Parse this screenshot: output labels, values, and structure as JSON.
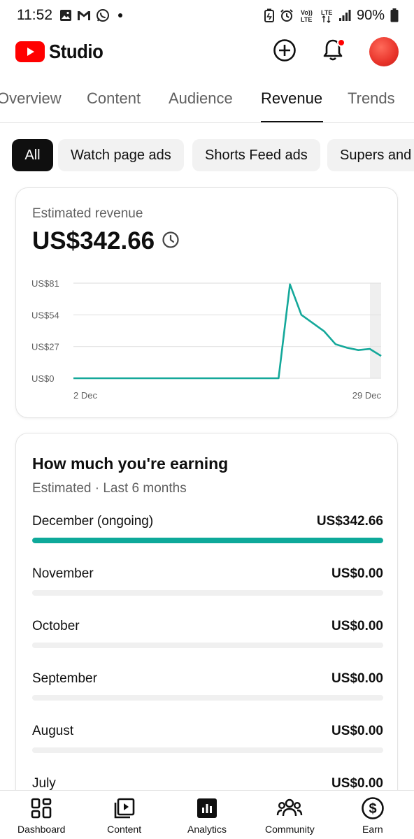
{
  "status_bar": {
    "time": "11:52",
    "battery": "90%",
    "network": "LTE",
    "left_icons": [
      "gallery-icon",
      "gmail-icon",
      "whatsapp-icon"
    ],
    "right_icons": [
      "battery-saver-icon",
      "alarm-icon",
      "volte-icon",
      "lte-icon",
      "signal-icon",
      "battery-icon"
    ]
  },
  "app_bar": {
    "brand": "Studio",
    "brand_color": "#ff0000",
    "icons": [
      "create-icon",
      "notifications-icon",
      "avatar"
    ]
  },
  "tabs": [
    {
      "label": "Overview",
      "active": false
    },
    {
      "label": "Content",
      "active": false
    },
    {
      "label": "Audience",
      "active": false
    },
    {
      "label": "Revenue",
      "active": true
    },
    {
      "label": "Trends",
      "active": false
    }
  ],
  "chips": [
    {
      "label": "All",
      "active": true
    },
    {
      "label": "Watch page ads",
      "active": false
    },
    {
      "label": "Shorts Feed ads",
      "active": false
    },
    {
      "label": "Supers and",
      "active": false
    }
  ],
  "revenue_card": {
    "label": "Estimated revenue",
    "value": "US$342.66"
  },
  "chart_data": {
    "type": "line",
    "title": "",
    "xlabel": "",
    "ylabel": "",
    "x_tick_labels": [
      "2 Dec",
      "29 Dec"
    ],
    "y_tick_labels": [
      "US$0",
      "US$27",
      "US$54",
      "US$81"
    ],
    "ylim": [
      0,
      81
    ],
    "grid": true,
    "line_color": "#14a89a",
    "x": [
      2,
      3,
      4,
      5,
      6,
      7,
      8,
      9,
      10,
      11,
      12,
      13,
      14,
      15,
      16,
      17,
      18,
      19,
      20,
      21,
      22,
      23,
      24,
      25,
      26,
      27,
      28,
      29
    ],
    "series": [
      {
        "values": [
          0,
          0,
          0,
          0,
          0,
          0,
          0,
          0,
          0,
          0,
          0,
          0,
          0,
          0,
          0,
          0,
          0,
          0,
          0,
          80,
          54,
          47,
          40,
          29,
          26,
          24,
          25,
          19
        ]
      }
    ]
  },
  "earnings": {
    "title": "How much you're earning",
    "subtitle": "Estimated · Last 6 months",
    "bar_color": "#0ea99a",
    "months": [
      {
        "name": "December (ongoing)",
        "value": "US$342.66",
        "fill": 1.0
      },
      {
        "name": "November",
        "value": "US$0.00",
        "fill": 0
      },
      {
        "name": "October",
        "value": "US$0.00",
        "fill": 0
      },
      {
        "name": "September",
        "value": "US$0.00",
        "fill": 0
      },
      {
        "name": "August",
        "value": "US$0.00",
        "fill": 0
      },
      {
        "name": "July",
        "value": "US$0.00",
        "fill": 0
      }
    ]
  },
  "bottom_nav": [
    {
      "label": "Dashboard",
      "icon": "dashboard-icon"
    },
    {
      "label": "Content",
      "icon": "content-icon"
    },
    {
      "label": "Analytics",
      "icon": "analytics-icon",
      "active": true
    },
    {
      "label": "Community",
      "icon": "community-icon"
    },
    {
      "label": "Earn",
      "icon": "earn-icon"
    }
  ]
}
